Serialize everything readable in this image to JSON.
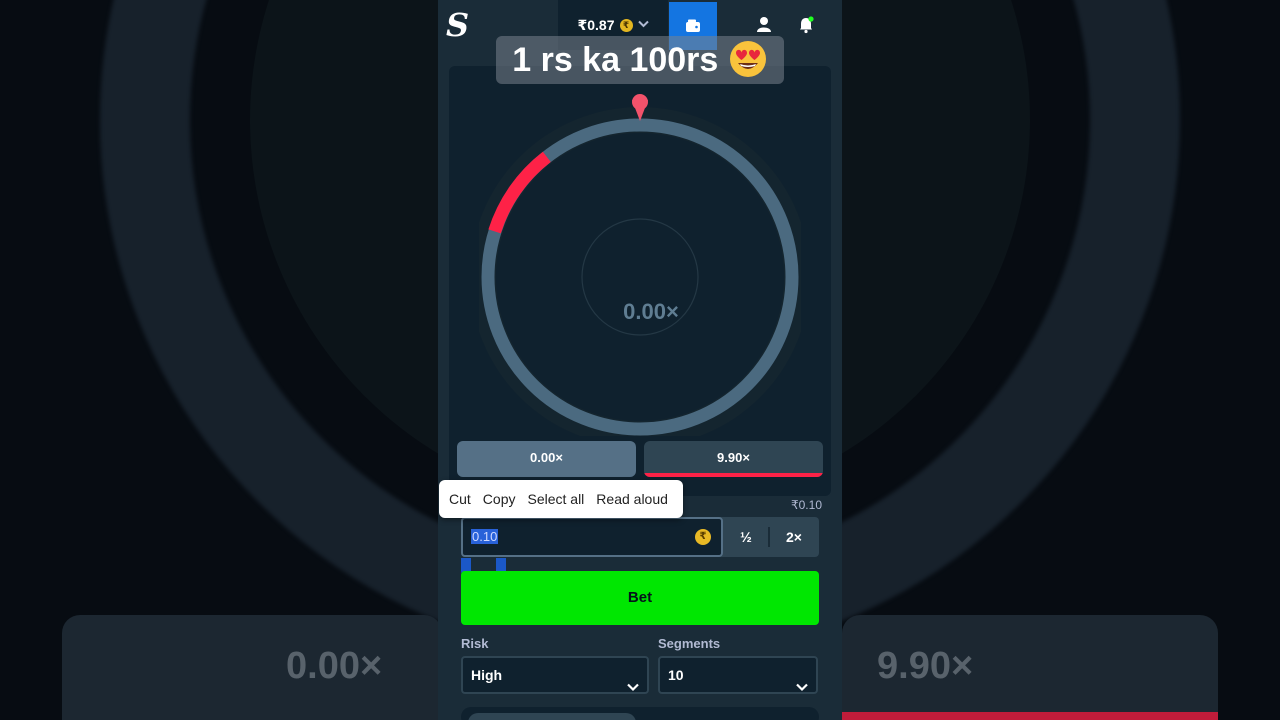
{
  "caption": {
    "text": "1 rs ka 100rs",
    "emoji": "heart-eyes-emoji"
  },
  "header": {
    "logo": "S",
    "balance": "₹0.87",
    "currency_symbol": "₹"
  },
  "game": {
    "current_multiplier": "0.00×",
    "payouts": [
      {
        "label": "0.00×",
        "color": "#557086"
      },
      {
        "label": "9.90×",
        "color": "#fe2247"
      }
    ]
  },
  "bet": {
    "amount_display": "₹0.10",
    "amount_value": "0.10",
    "half_label": "½",
    "double_label": "2×",
    "bet_label": "Bet"
  },
  "context_menu": {
    "items": [
      "Cut",
      "Copy",
      "Select all",
      "Read aloud"
    ]
  },
  "risk": {
    "label": "Risk",
    "value": "High"
  },
  "segments": {
    "label": "Segments",
    "value": "10"
  },
  "background": {
    "left_multiplier": "0.00×",
    "right_multiplier": "9.90×"
  },
  "colors": {
    "bet_button": "#00e701",
    "accent_red": "#fe2247",
    "wallet_blue": "#1475e1",
    "panel_dark": "#0f212e"
  }
}
